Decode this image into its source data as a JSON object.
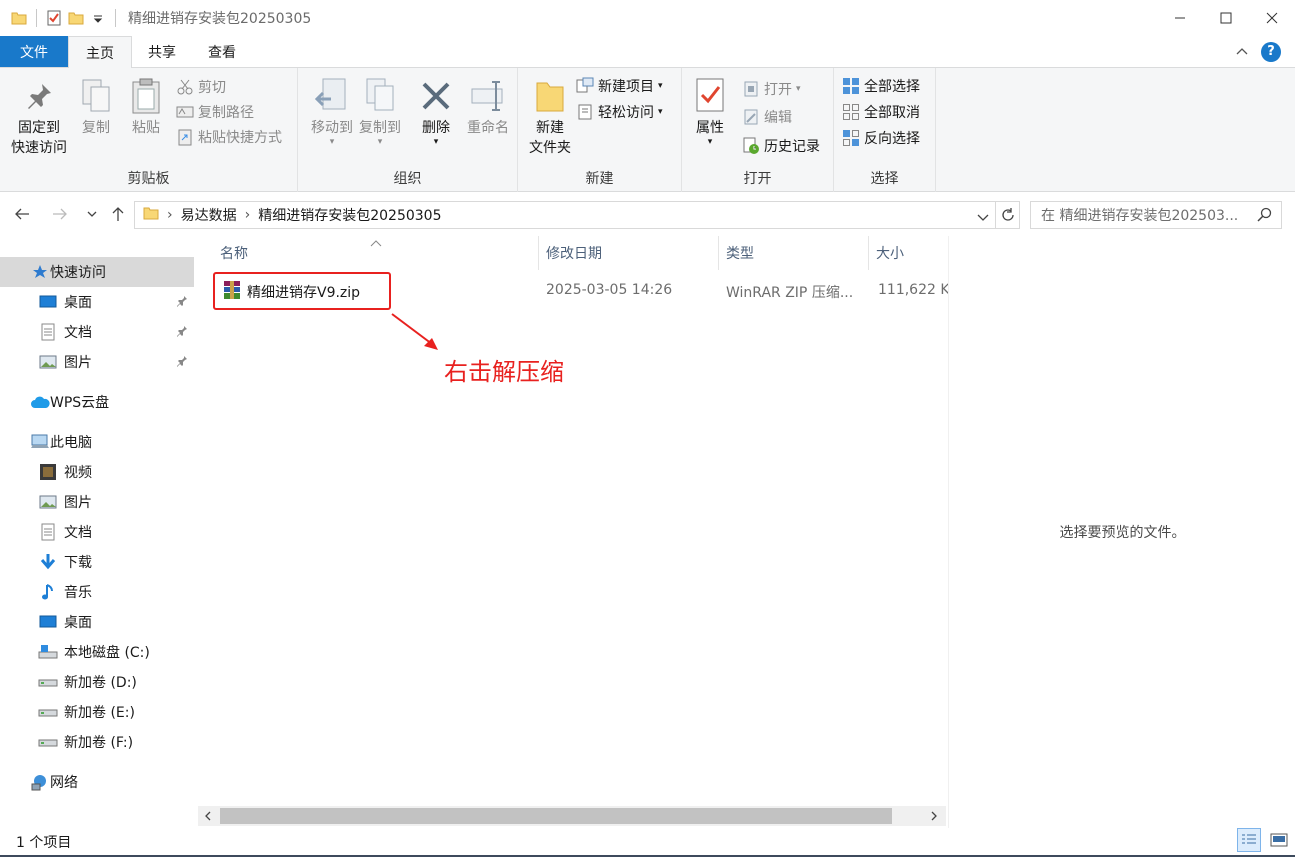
{
  "window": {
    "title": "精细进销存安装包20250305",
    "controls": [
      "minimize-icon",
      "maximize-icon",
      "close-icon"
    ]
  },
  "ribbon_tabs": {
    "file": "文件",
    "home": "主页",
    "share": "共享",
    "view": "查看"
  },
  "ribbon": {
    "clipboard": {
      "label": "剪贴板",
      "pin": "固定到\n快速访问",
      "pin_line1": "固定到",
      "pin_line2": "快速访问",
      "copy": "复制",
      "paste": "粘贴",
      "cut": "剪切",
      "copy_path": "复制路径",
      "paste_shortcut": "粘贴快捷方式"
    },
    "organize": {
      "label": "组织",
      "move_to": "移动到",
      "copy_to": "复制到",
      "delete": "删除",
      "rename": "重命名"
    },
    "new": {
      "label": "新建",
      "new_folder_line1": "新建",
      "new_folder_line2": "文件夹",
      "new_item": "新建项目",
      "easy_access": "轻松访问"
    },
    "open": {
      "label": "打开",
      "properties": "属性",
      "open": "打开",
      "edit": "编辑",
      "history": "历史记录"
    },
    "select": {
      "label": "选择",
      "select_all": "全部选择",
      "select_none": "全部取消",
      "invert": "反向选择"
    }
  },
  "address": {
    "crumbs": [
      "易达数据",
      "精细进销存安装包20250305"
    ],
    "search_placeholder": "在 精细进销存安装包202503..."
  },
  "nav": {
    "quick_access": "快速访问",
    "desktop": "桌面",
    "documents": "文档",
    "pictures": "图片",
    "wps": "WPS云盘",
    "this_pc": "此电脑",
    "videos": "视频",
    "pictures2": "图片",
    "documents2": "文档",
    "downloads": "下载",
    "music": "音乐",
    "desktop2": "桌面",
    "drive_c": "本地磁盘 (C:)",
    "drive_d": "新加卷 (D:)",
    "drive_e": "新加卷 (E:)",
    "drive_f": "新加卷 (F:)",
    "network": "网络"
  },
  "columns": {
    "name": "名称",
    "date": "修改日期",
    "type": "类型",
    "size": "大小"
  },
  "files": [
    {
      "name": "精细进销存V9.zip",
      "date": "2025-03-05 14:26",
      "type": "WinRAR ZIP 压缩...",
      "size": "111,622 K"
    }
  ],
  "annotation": {
    "text": "右击解压缩",
    "color": "#e8211f"
  },
  "preview": {
    "message": "选择要预览的文件。"
  },
  "status": {
    "count": "1 个项目"
  },
  "colors": {
    "accent": "#1979ca",
    "annotation": "#e8211f"
  }
}
